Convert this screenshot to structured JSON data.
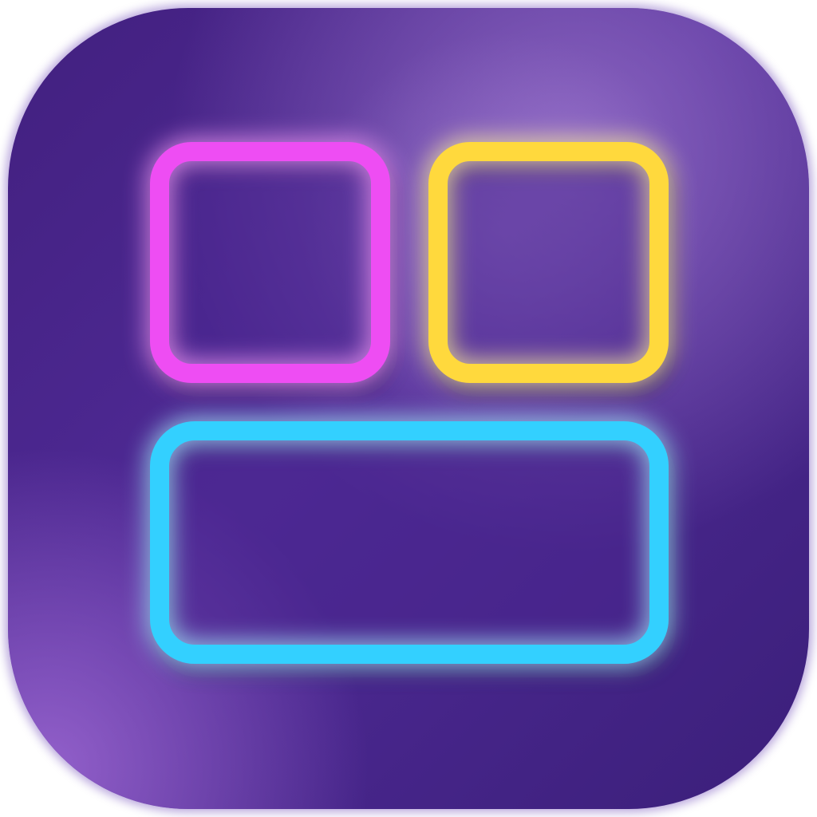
{
  "app_icon": {
    "name": "widget-layout-app-icon",
    "background": {
      "base": "#4b2590",
      "dark": "#3d1e7e",
      "light": "#8a5cc0",
      "highlight": "#a37fd1",
      "edge_glow": "#9a72cf"
    },
    "tiles": [
      {
        "id": "top-left-tile",
        "outline_color": "#ee4df3",
        "glow_color": "#f59af8"
      },
      {
        "id": "top-right-tile",
        "outline_color": "#ffd93d",
        "glow_color": "#fff0a0"
      },
      {
        "id": "bottom-wide-tile",
        "outline_color": "#33d0ff",
        "glow_color": "#a6ecff"
      }
    ]
  }
}
